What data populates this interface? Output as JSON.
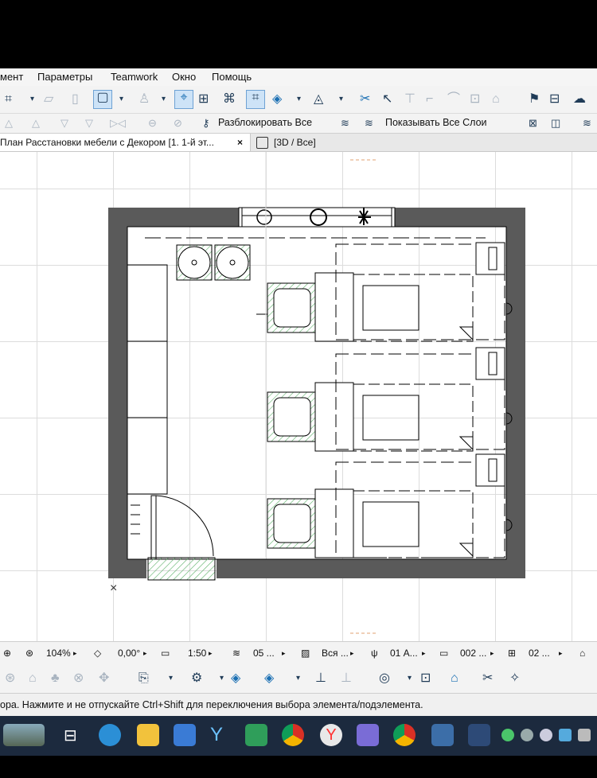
{
  "menu": {
    "items": [
      "мент",
      "Параметры",
      "Teamwork",
      "Окно",
      "Помощь"
    ]
  },
  "toolbar2": {
    "unlock_all": "Разблокировать Все",
    "show_all_layers": "Показывать Все Слои"
  },
  "tabs": [
    {
      "label": "План Расстановки мебели с Декором [1. 1-й эт...",
      "close": "×"
    },
    {
      "label": "[3D / Все]"
    }
  ],
  "bottom": {
    "zoom": "104%",
    "angle": "0,00°",
    "scale": "1:50",
    "layers": "05 ...",
    "model": "Вся ...",
    "pen": "01 А...",
    "dim": "002 ...",
    "renovation": "02 ..."
  },
  "status": {
    "text": "ора. Нажмите и не отпускайте Ctrl+Shift для переключения выбора элемента/подэлемента."
  },
  "canvas": {
    "origin_marker": "×"
  },
  "colors": {
    "wall": "#5a5a5a",
    "hatch_green": "#5fb36b",
    "taskbar": "#1c2a3e"
  }
}
